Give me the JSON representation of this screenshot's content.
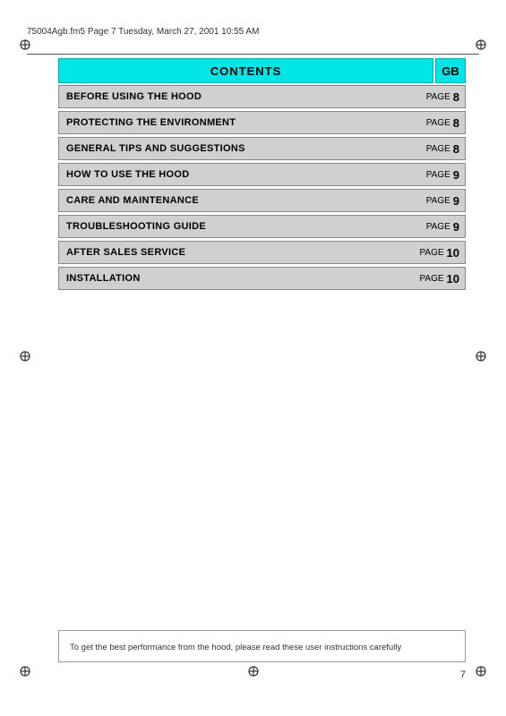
{
  "header": {
    "file_info": "75004Agb.fm5  Page 7  Tuesday, March 27, 2001  10:55 AM"
  },
  "contents_title": "CONTENTS",
  "contents_gb": "GB",
  "toc": [
    {
      "title": "BEFORE USING THE HOOD",
      "page_label": "PAGE",
      "page_num": "8"
    },
    {
      "title": "PROTECTING THE ENVIRONMENT",
      "page_label": "PAGE",
      "page_num": "8"
    },
    {
      "title": "GENERAL TIPS AND SUGGESTIONS",
      "page_label": "PAGE",
      "page_num": "8"
    },
    {
      "title": "HOW TO USE THE HOOD",
      "page_label": "PAGE",
      "page_num": "9"
    },
    {
      "title": "CARE AND MAINTENANCE",
      "page_label": "PAGE",
      "page_num": "9"
    },
    {
      "title": "TROUBLESHOOTING GUIDE",
      "page_label": "PAGE",
      "page_num": "9"
    },
    {
      "title": "AFTER SALES SERVICE",
      "page_label": "PAGE",
      "page_num": "10"
    },
    {
      "title": "INSTALLATION",
      "page_label": "PAGE",
      "page_num": "10"
    }
  ],
  "bottom_note": "To get the best performance from the hood, please read these user instructions carefully",
  "page_number": "7"
}
